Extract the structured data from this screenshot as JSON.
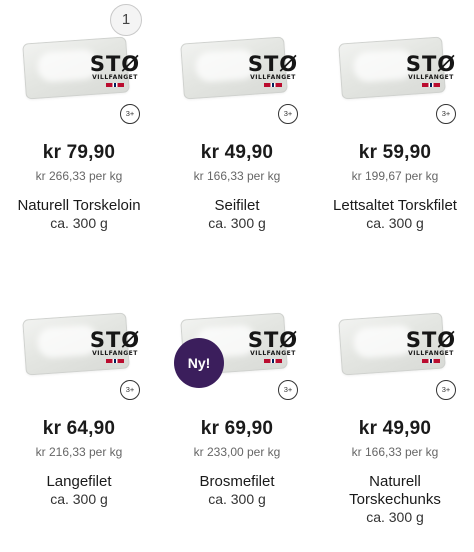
{
  "products": [
    {
      "price": "kr 79,90",
      "unit_price": "kr 266,33 per kg",
      "name": "Naturell Torskeloin",
      "weight": "ca. 300 g",
      "qty": "1"
    },
    {
      "price": "kr 49,90",
      "unit_price": "kr 166,33 per kg",
      "name": "Seifilet",
      "weight": "ca. 300 g"
    },
    {
      "price": "kr 59,90",
      "unit_price": "kr 199,67 per kg",
      "name": "Lettsaltet Torskfilet",
      "weight": "ca. 300 g"
    },
    {
      "price": "kr 64,90",
      "unit_price": "kr 216,33 per kg",
      "name": "Langefilet",
      "weight": "ca. 300 g"
    },
    {
      "price": "kr 69,90",
      "unit_price": "kr 233,00 per kg",
      "name": "Brosmefilet",
      "weight": "ca. 300 g",
      "badge": "Ny!"
    },
    {
      "price": "kr 49,90",
      "unit_price": "kr 166,33 per kg",
      "name": "Naturell Torskechunks",
      "weight": "ca. 300 g"
    }
  ],
  "brand": {
    "logo_main": "STØ",
    "logo_sub": "VILLFANGET",
    "age_label": "3+"
  },
  "colors": {
    "new_badge": "#3b1e5c"
  }
}
